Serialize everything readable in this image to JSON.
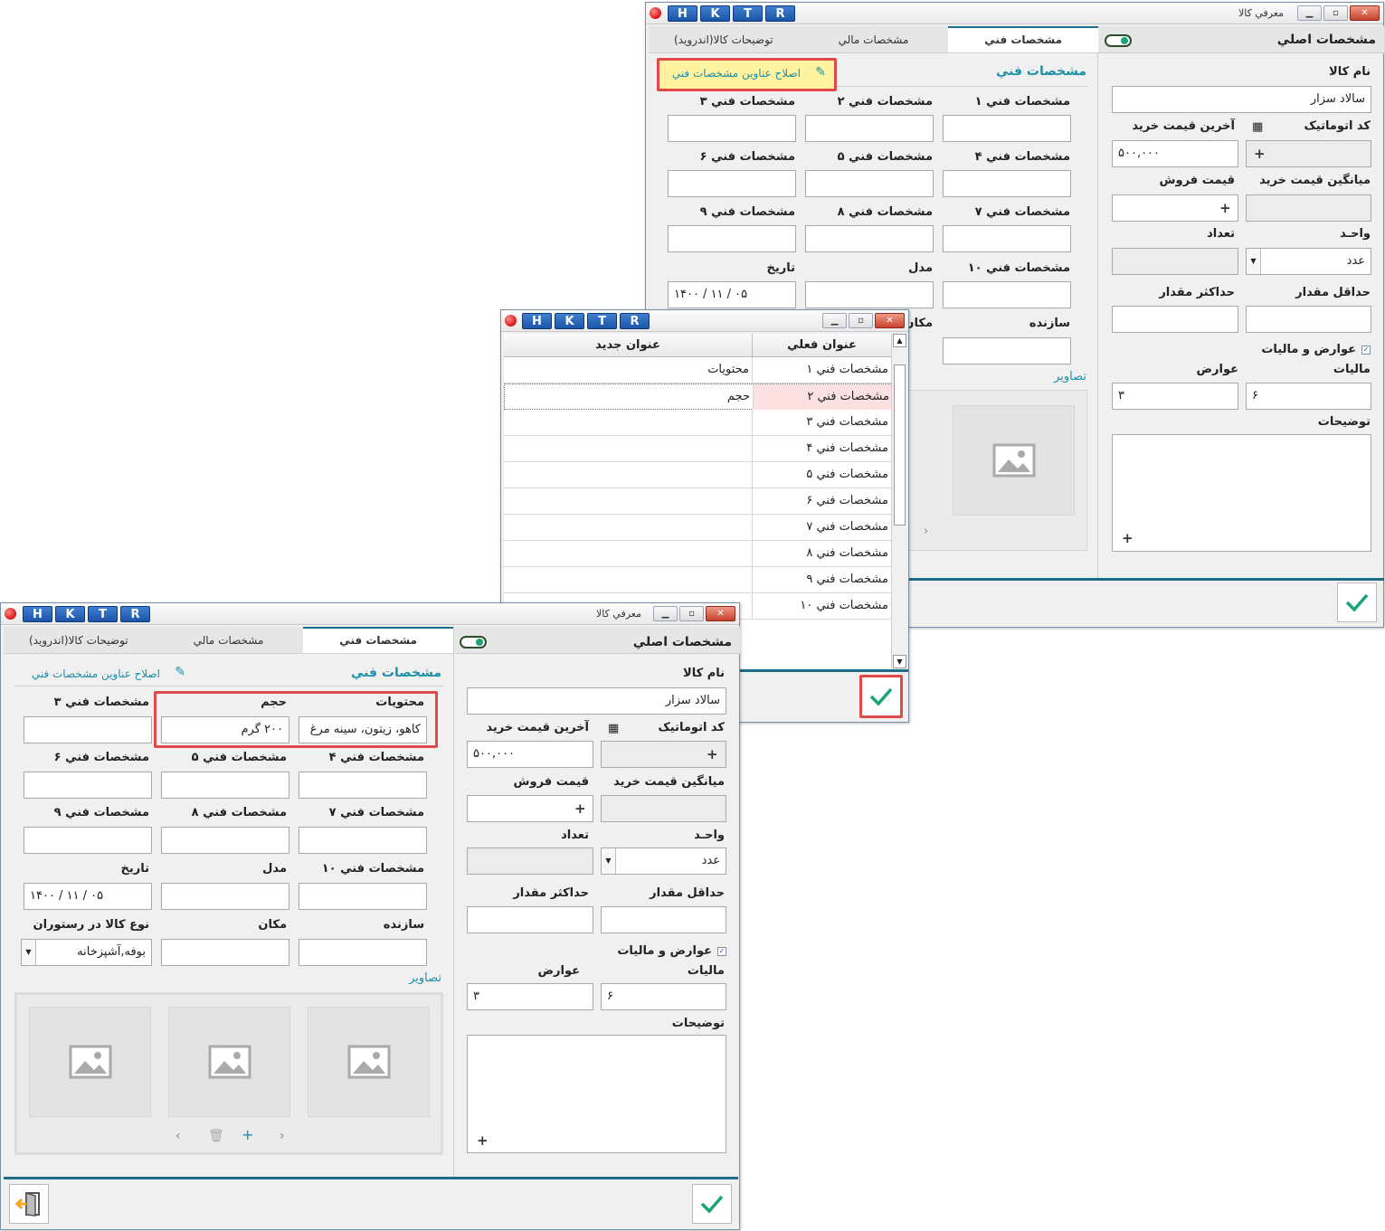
{
  "common": {
    "hotkeys": [
      "H",
      "K",
      "T",
      "R"
    ],
    "window_title": "معرفي كالا",
    "tabs": [
      "مشخصات فني",
      "مشخصات مالي",
      "توضيحات كالا(اندرويد)"
    ],
    "main_specs": "مشخصات اصلي",
    "tech_specs": "مشخصات فني",
    "fix_titles": "اصلاح عناوين مشخصات فني",
    "images": "تصاوير",
    "labels": {
      "name": "نام كالا",
      "auto_code": "كد اتوماتيک",
      "last_price": "آخرين قيمت خريد",
      "avg_price": "ميانگين قيمت خريد",
      "sale_price": "قيمت فروش",
      "unit": "واحـد",
      "count": "تعداد",
      "min_qty": "حداقل مقدار",
      "max_qty": "حداكثر مقدار",
      "duties_taxes": "عوارض و ماليات",
      "tax": "ماليات",
      "duty": "عوارض",
      "description": "توضيحات",
      "spec1": "مشخصات فني ۱",
      "spec2": "مشخصات فني ۲",
      "spec3": "مشخصات فني ۳",
      "spec4": "مشخصات فني ۴",
      "spec5": "مشخصات فني ۵",
      "spec6": "مشخصات فني ۶",
      "spec7": "مشخصات فني ۷",
      "spec8": "مشخصات فني ۸",
      "spec9": "مشخصات فني ۹",
      "spec10": "مشخصات فني ۱۰",
      "model": "مدل",
      "date": "تاريخ",
      "maker": "سازنده",
      "place": "مكان",
      "place_partial": "مكان",
      "food_type": "نوع كالا در رستوران"
    },
    "values": {
      "name": "سالاد سزار",
      "last_price": "۵۰۰,۰۰۰",
      "unit": "عدد",
      "tax": "۶",
      "duty": "۳",
      "date": "۱۴۰۰ / ۱۱ / ۰۵",
      "contents_value": "كاهو، زيتون، سينه مرغ",
      "volume_value": "۲۰۰ گرم",
      "food_type_value": "بوفه,آشپزخانه"
    },
    "plus": "+"
  },
  "front": {
    "spec_label1": "محتويات",
    "spec_label2": "حجم"
  },
  "dialog": {
    "col_current": "عنوان فعلي",
    "col_new": "عنوان جديد",
    "rows": [
      {
        "current": "مشخصات فني ۱",
        "new": "محتويات"
      },
      {
        "current": "مشخصات فني ۲",
        "new": "حجم"
      },
      {
        "current": "مشخصات فني ۳",
        "new": ""
      },
      {
        "current": "مشخصات فني ۴",
        "new": ""
      },
      {
        "current": "مشخصات فني ۵",
        "new": ""
      },
      {
        "current": "مشخصات فني ۶",
        "new": ""
      },
      {
        "current": "مشخصات فني ۷",
        "new": ""
      },
      {
        "current": "مشخصات فني ۸",
        "new": ""
      },
      {
        "current": "مشخصات فني ۹",
        "new": ""
      },
      {
        "current": "مشخصات فني ۱۰",
        "new": ""
      }
    ]
  },
  "colors": {
    "accent": "#1e8fa8",
    "tab_border": "#1b6d8a",
    "highlight_red": "#e04a4a",
    "highlight_yellow": "#fff3a0",
    "check_green": "#1aa37a"
  }
}
